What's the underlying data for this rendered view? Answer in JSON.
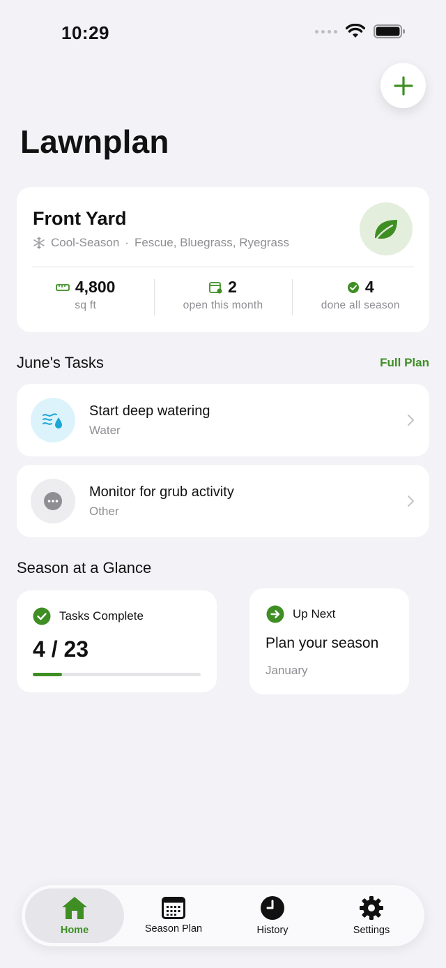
{
  "status_bar": {
    "time": "10:29"
  },
  "app": {
    "title": "Lawnplan"
  },
  "yard": {
    "name": "Front Yard",
    "season": "Cool-Season",
    "separator": "·",
    "grasses": "Fescue, Bluegrass, Ryegrass",
    "stats": [
      {
        "value": "4,800",
        "label": "sq ft",
        "icon": "ruler-icon"
      },
      {
        "value": "2",
        "label": "open this month",
        "icon": "calendar-icon"
      },
      {
        "value": "4",
        "label": "done all season",
        "icon": "check-circle-icon"
      }
    ]
  },
  "tasks_section": {
    "title": "June's Tasks",
    "link": "Full Plan",
    "items": [
      {
        "title": "Start deep watering",
        "category": "Water",
        "icon": "water-icon"
      },
      {
        "title": "Monitor for grub activity",
        "category": "Other",
        "icon": "more-icon"
      }
    ]
  },
  "glance": {
    "title": "Season at a Glance",
    "complete": {
      "label": "Tasks Complete",
      "value": "4 / 23",
      "progress": 0.174
    },
    "next": {
      "label": "Up Next",
      "title": "Plan your season",
      "when": "January"
    }
  },
  "tabs": [
    {
      "label": "Home",
      "icon": "home-icon",
      "active": true
    },
    {
      "label": "Season Plan",
      "icon": "calendar-grid-icon",
      "active": false
    },
    {
      "label": "History",
      "icon": "clock-icon",
      "active": false
    },
    {
      "label": "Settings",
      "icon": "gear-icon",
      "active": false
    }
  ],
  "colors": {
    "accent": "#3E8E24",
    "background": "#F2F2F7",
    "water_bg": "#DDF3FB",
    "water": "#1AA6D6"
  }
}
